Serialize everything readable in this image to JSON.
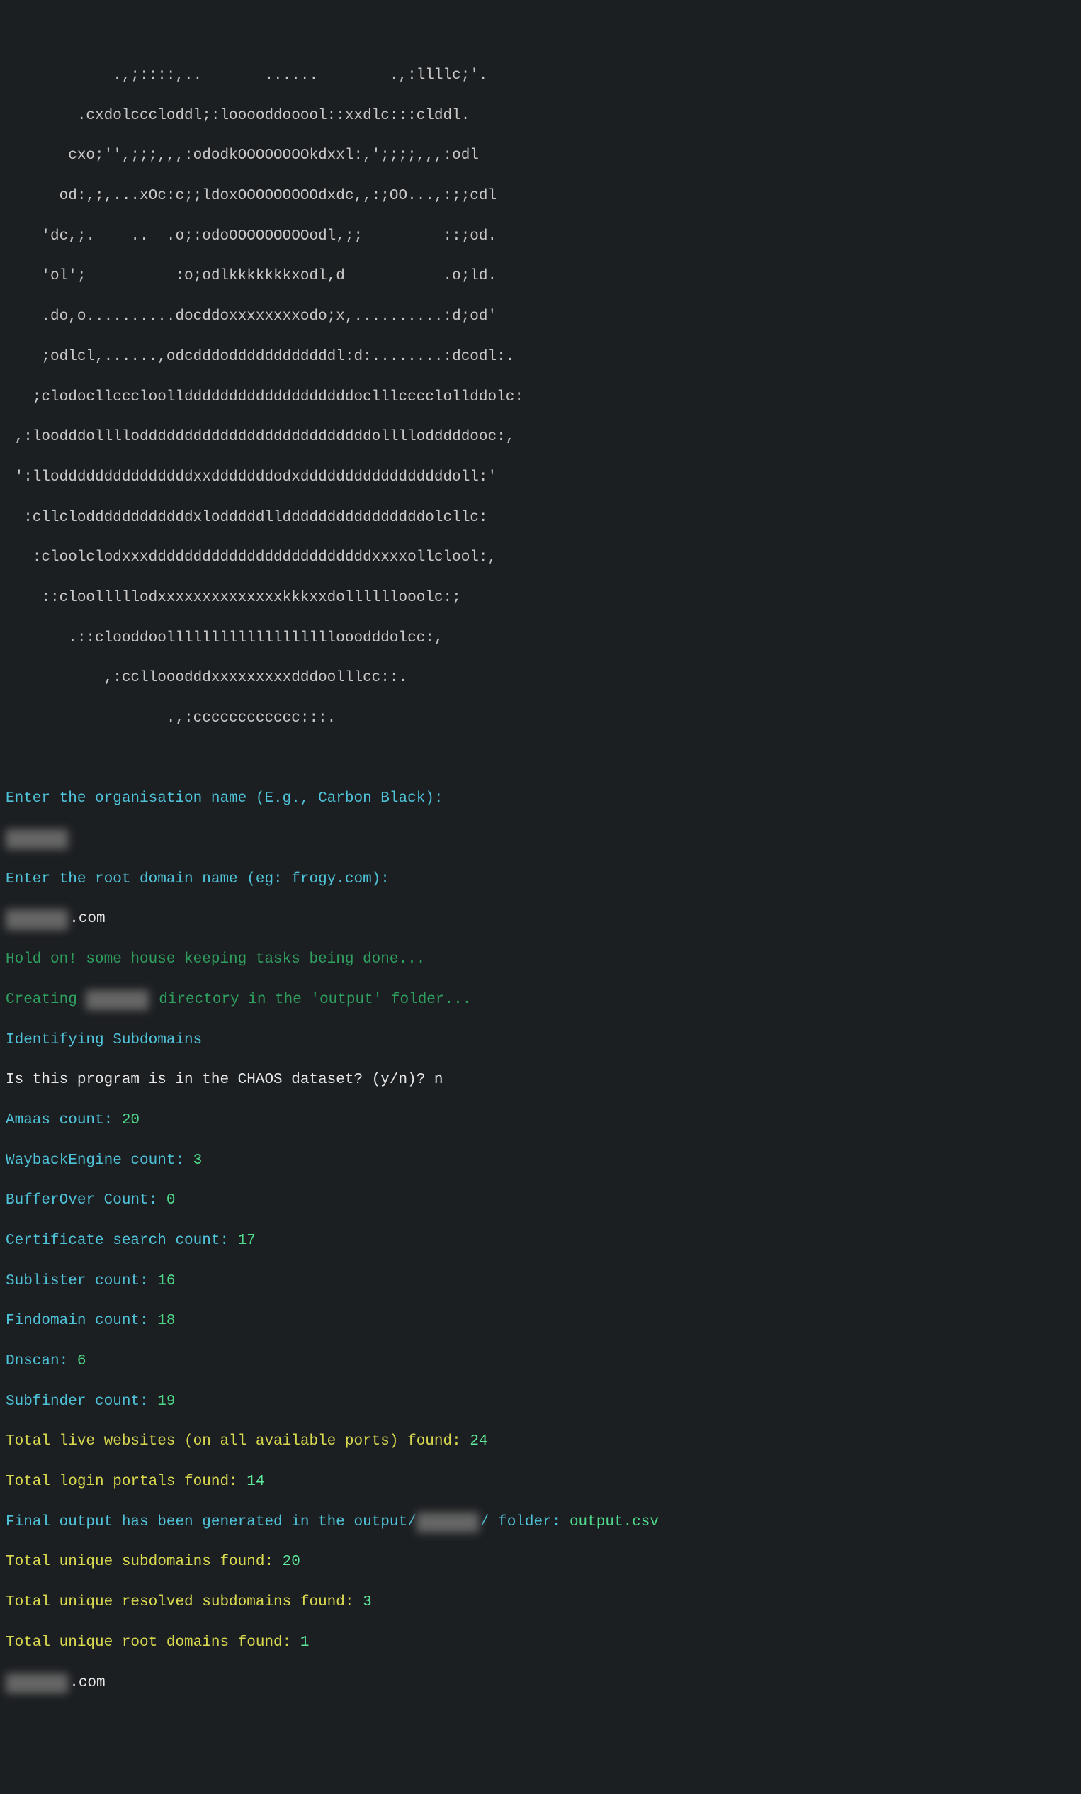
{
  "ascii": [
    "            .,;::::,..       ......        .,:llllc;'.",
    "        .cxdolcccloddl;:looooddooool::xxdlc:::clddl.",
    "       cxo;'',;;;,,,:ododkOOOOOOOOkdxxl:,';;;;,,,:odl",
    "      od:,;,...xOc:c;;ldoxOOOOOOOOOdxdc,,:;OO...,:;;cdl",
    "    'dc,;.    ..  .o;:odoOOOOOOOOOodl,;;         ::;od.",
    "    'ol';          :o;odlkkkkkkkxodl,d           .o;ld.",
    "    .do,o..........docddoxxxxxxxxodo;x,..........:d;od'",
    "    ;odlcl,......,odcdddoddddddddddddl:d:........:dcodl:.",
    "   ;clodocllcccloolldddddddddddddddddddoclllcccclollddolc:",
    " ,:loodddolllloddddddddddddddddddddddddddollllodddddooc:,",
    " ':llodddddddddddddddxxdddddddodxdddddddddddddddddoll:'",
    "  :cllcloddddddddddddxlodddddllddddddddddddddddolcllc:",
    "   :cloolclodxxxdddddddddddddddddddddddddxxxxollclool:,",
    "    ::cloolllllodxxxxxxxxxxxxxxkkkxxdollllllooolc:;",
    "       .::clooddoolllllllllllllllllllooodddolcc:,",
    "           ,:ccllooodddxxxxxxxxxdddoolllcc::.",
    "                  .,:cccccccccccc:::."
  ],
  "prompts": {
    "org_label": "Enter the organisation name (E.g., Carbon Black):",
    "org_value_hidden": "███████",
    "domain_label": "Enter the root domain name (eg: frogy.com):",
    "domain_value_hidden": "███████",
    "domain_suffix": ".com"
  },
  "status": {
    "housekeeping": "Hold on! some house keeping tasks being done...",
    "creating_pre": "Creating ",
    "creating_hidden": "███████",
    "creating_post": " directory in the 'output' folder...",
    "identifying": "Identifying Subdomains",
    "chaos_q": "Is this program is in the CHAOS dataset? (y/n)? ",
    "chaos_a": "n"
  },
  "counts": {
    "amaas_label": "Amaas count: ",
    "amaas": "20",
    "wayback_label": "WaybackEngine count: ",
    "wayback": "3",
    "bufferover_label": "BufferOver Count: ",
    "bufferover": "0",
    "cert_label": "Certificate search count: ",
    "cert": "17",
    "sublister_label": "Sublister count: ",
    "sublister": "16",
    "findomain_label": "Findomain count: ",
    "findomain": "18",
    "dnscan_label": "Dnscan: ",
    "dnscan": "6",
    "subfinder_label": "Subfinder count: ",
    "subfinder": "19"
  },
  "totals": {
    "live_label": "Total live websites (on all available ports) found: ",
    "live": "24",
    "login_label": "Total login portals found: ",
    "login": "14",
    "final_pre": "Final output has been generated in the output/",
    "final_hidden": "███████",
    "final_post": "/ folder: ",
    "final_file": "output.csv",
    "uniq_sub_label": "Total unique subdomains found: ",
    "uniq_sub": "20",
    "uniq_res_label": "Total unique resolved subdomains found: ",
    "uniq_res": "3",
    "uniq_root_label": "Total unique root domains found: ",
    "uniq_root": "1",
    "final_domain_hidden": "███████",
    "final_domain_suffix": ".com"
  }
}
